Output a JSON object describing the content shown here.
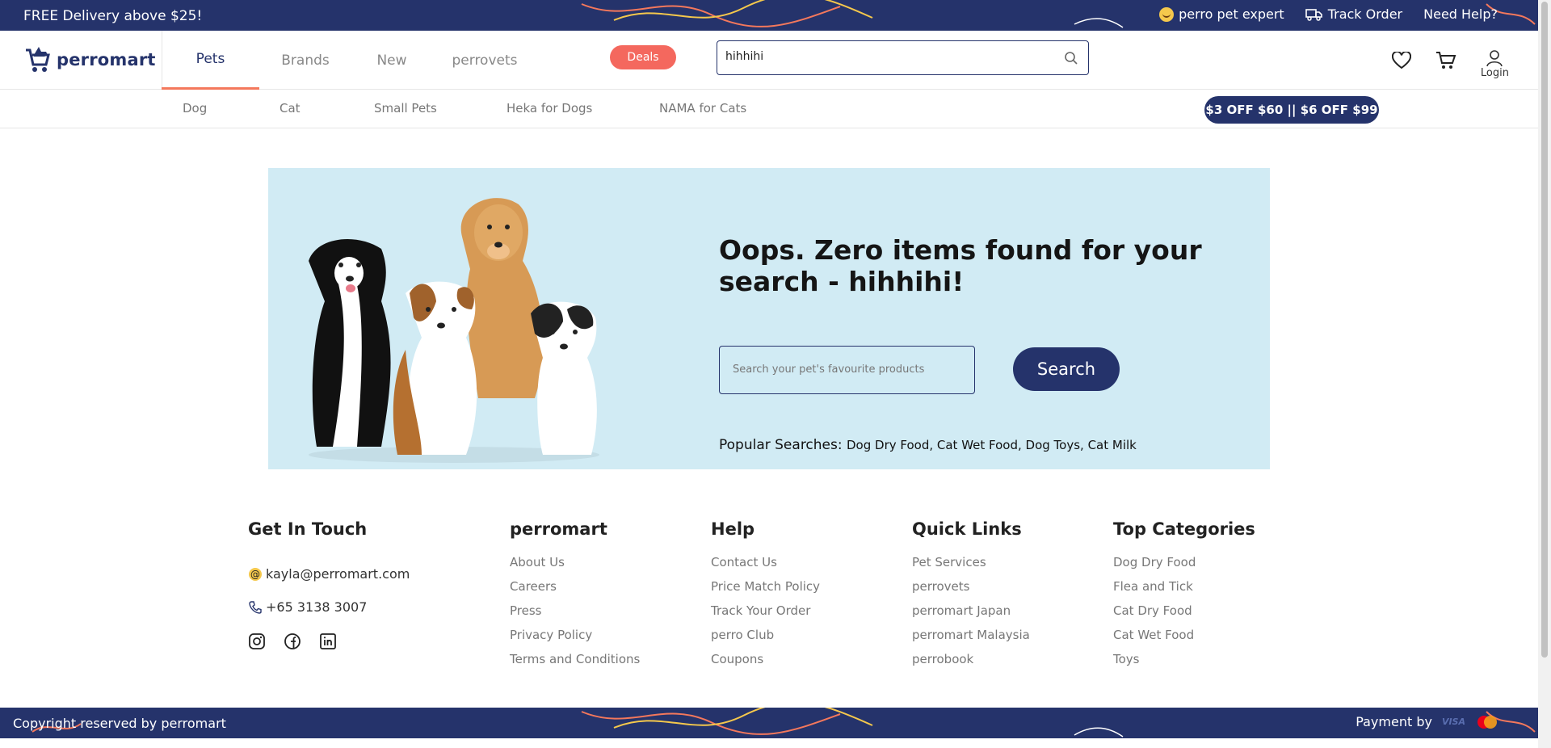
{
  "topbar": {
    "promo": "FREE Delivery above $25!",
    "expert": "perro pet expert",
    "track": "Track Order",
    "help": "Need Help?"
  },
  "header": {
    "logo_text": "perromart",
    "tabs": [
      {
        "label": "Pets",
        "active": true
      },
      {
        "label": "Brands",
        "active": false
      },
      {
        "label": "New",
        "active": false
      },
      {
        "label": "perrovets",
        "active": false
      }
    ],
    "deals_label": "Deals",
    "search_value": "hihhihi",
    "login_label": "Login"
  },
  "subnav": {
    "links": [
      "Dog",
      "Cat",
      "Small Pets",
      "Heka for Dogs",
      "NAMA for Cats"
    ],
    "offer": "$3 OFF $60 || $6 OFF $99"
  },
  "hero": {
    "title": "Oops. Zero items found for your search - hihhihi!",
    "search_placeholder": "Search your pet's favourite products",
    "search_button": "Search",
    "popular_label": "Popular Searches:",
    "popular_links": "Dog Dry Food, Cat Wet Food, Dog Toys, Cat Milk"
  },
  "footer": {
    "contact": {
      "title": "Get In Touch",
      "email": "kayla@perromart.com",
      "phone": "+65 3138 3007"
    },
    "perromart": {
      "title": "perromart",
      "links": [
        "About Us",
        "Careers",
        "Press",
        "Privacy Policy",
        "Terms and Conditions"
      ]
    },
    "help": {
      "title": "Help",
      "links": [
        "Contact Us",
        "Price Match Policy",
        "Track Your Order",
        "perro Club",
        "Coupons"
      ]
    },
    "quick": {
      "title": "Quick Links",
      "links": [
        "Pet Services",
        "perrovets",
        "perromart Japan",
        "perromart Malaysia",
        "perrobook"
      ]
    },
    "categories": {
      "title": "Top Categories",
      "links": [
        "Dog Dry Food",
        "Flea and Tick",
        "Cat Dry Food",
        "Cat Wet Food",
        "Toys"
      ]
    }
  },
  "bottombar": {
    "copyright": "Copyright reserved by perromart",
    "payment": "Payment by",
    "visa": "VISA"
  },
  "colors": {
    "brand_navy": "#25336b",
    "accent_coral": "#f4685e",
    "hero_bg": "#d1ebf4"
  }
}
